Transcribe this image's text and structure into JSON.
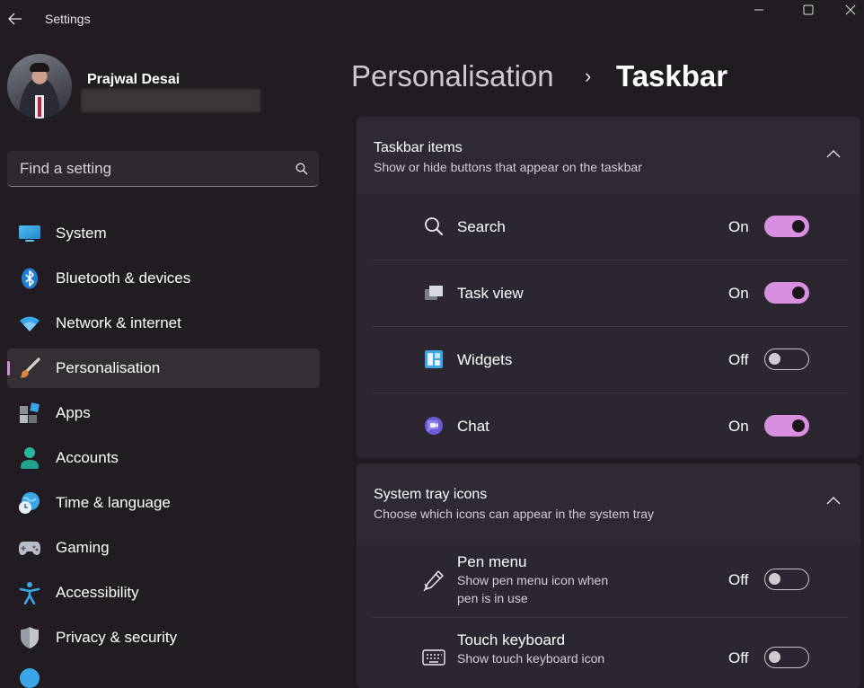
{
  "titlebar": {
    "title": "Settings"
  },
  "profile": {
    "name": "Prajwal Desai"
  },
  "search": {
    "placeholder": "Find a setting"
  },
  "nav": {
    "items": [
      {
        "label": "System",
        "icon": "monitor-icon"
      },
      {
        "label": "Bluetooth & devices",
        "icon": "bluetooth-icon"
      },
      {
        "label": "Network & internet",
        "icon": "wifi-icon"
      },
      {
        "label": "Personalisation",
        "icon": "brush-icon",
        "active": true
      },
      {
        "label": "Apps",
        "icon": "apps-icon"
      },
      {
        "label": "Accounts",
        "icon": "person-icon"
      },
      {
        "label": "Time & language",
        "icon": "globe-clock-icon"
      },
      {
        "label": "Gaming",
        "icon": "gamepad-icon"
      },
      {
        "label": "Accessibility",
        "icon": "accessibility-icon"
      },
      {
        "label": "Privacy & security",
        "icon": "shield-icon"
      }
    ]
  },
  "header": {
    "parent": "Personalisation",
    "separator": "›",
    "current": "Taskbar"
  },
  "taskbar_items": {
    "title": "Taskbar items",
    "subtitle": "Show or hide buttons that appear on the taskbar",
    "rows": [
      {
        "label": "Search",
        "state": "On",
        "icon": "search-icon"
      },
      {
        "label": "Task view",
        "state": "On",
        "icon": "task-view-icon"
      },
      {
        "label": "Widgets",
        "state": "Off",
        "icon": "widgets-icon"
      },
      {
        "label": "Chat",
        "state": "On",
        "icon": "chat-icon"
      }
    ]
  },
  "system_tray": {
    "title": "System tray icons",
    "subtitle": "Choose which icons can appear in the system tray",
    "rows": [
      {
        "label": "Pen menu",
        "desc": "Show pen menu icon when pen is in use",
        "state": "Off",
        "icon": "pen-icon"
      },
      {
        "label": "Touch keyboard",
        "desc": "Show touch keyboard icon",
        "state": "Off",
        "icon": "keyboard-icon"
      }
    ]
  },
  "colors": {
    "accent": "#d88fe0",
    "background": "#211c22",
    "card": "#2b2630"
  }
}
